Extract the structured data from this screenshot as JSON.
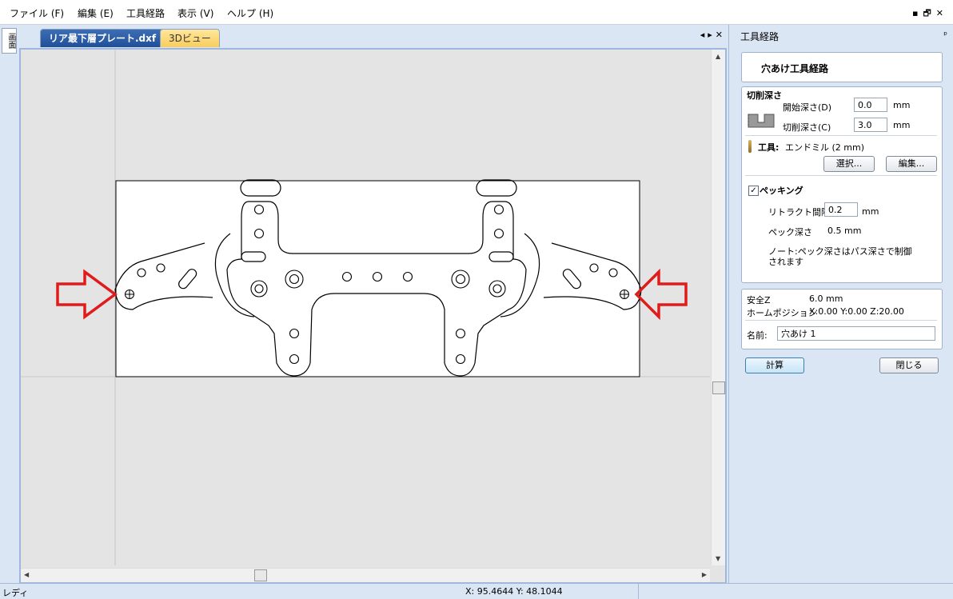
{
  "menu": [
    "ファイル (F)",
    "編集 (E)",
    "工具経路",
    "表示 (V)",
    "ヘルプ (H)"
  ],
  "window_controls": [
    "▪",
    "🗗",
    "✕"
  ],
  "left_strip_label": "画面",
  "tabs": [
    {
      "label": "リア最下層プレート.dxf",
      "active": true
    },
    {
      "label": "3Dビュー",
      "active": false
    }
  ],
  "tab_controls": [
    "◂",
    "▸",
    "✕"
  ],
  "panel": {
    "title": "工具経路",
    "pin": "ᵖ",
    "header": "穴あけ工具経路",
    "depth_section": "切削深さ",
    "start_depth_label": "開始深さ(D)",
    "start_depth_value": "0.0",
    "cut_depth_label": "切削深さ(C)",
    "cut_depth_value": "3.0",
    "unit_mm": "mm",
    "tool_label": "工具:",
    "tool_value": "エンドミル (2 mm)",
    "select_button": "選択...",
    "edit_button": "編集...",
    "pecking_checked": true,
    "pecking_label": "ペッキング",
    "retract_label": "リトラクト間隔",
    "retract_value": "0.2",
    "retract_unit": "mm",
    "peck_depth_label": "ペック深さ",
    "peck_depth_value": "0.5 mm",
    "note": "ノート:ペック深さはパス深さで制御されます",
    "safe_z_label": "安全Z",
    "safe_z_value": "6.0 mm",
    "home_label": "ホームポジション",
    "home_value": "X:0.00 Y:0.00 Z:20.00",
    "name_label": "名前:",
    "name_value": "穴あけ 1",
    "calculate_button": "計算",
    "close_button": "閉じる"
  },
  "status": {
    "ready": "レディ",
    "coords": "X: 95.4644 Y: 48.1044"
  },
  "colors": {
    "annotation_arrow": "#e01b1b",
    "active_tab": "#2b5ba8",
    "inactive_tab": "#f8cd5d",
    "viewport_border": "#9db7e1"
  }
}
